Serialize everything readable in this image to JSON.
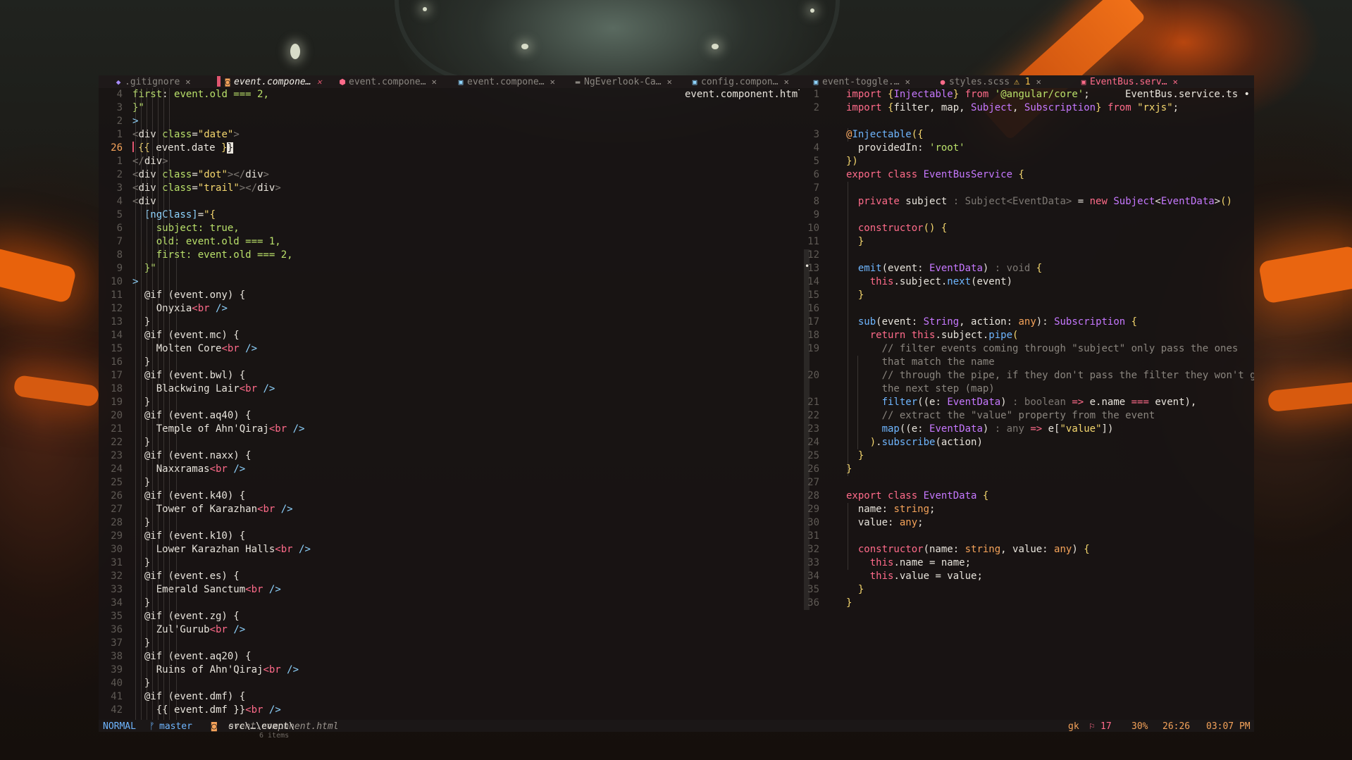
{
  "tabs": [
    {
      "icon": "git-icon",
      "icon_color": "#a88cff",
      "label": ".gitignore",
      "state": "normal"
    },
    {
      "icon": "html-icon",
      "icon_color": "#f5a35a",
      "label": "event.compone…",
      "state": "active"
    },
    {
      "icon": "angular-icon",
      "icon_color": "#ff6b8a",
      "label": "event.compone…",
      "state": "normal"
    },
    {
      "icon": "ts-icon",
      "icon_color": "#8fd4ff",
      "label": "event.compone…",
      "state": "normal"
    },
    {
      "icon": "folder-icon",
      "icon_color": "#8a8680",
      "label": "NgEverlook-Ca…",
      "state": "normal"
    },
    {
      "icon": "ts-icon",
      "icon_color": "#8fd4ff",
      "label": "config.compon…",
      "state": "normal"
    },
    {
      "icon": "ts-icon",
      "icon_color": "#8fd4ff",
      "label": "event-toggle.…",
      "state": "normal"
    },
    {
      "icon": "sass-icon",
      "icon_color": "#ff6b8a",
      "label": "styles.scss",
      "state": "warn",
      "warn": "⚠ 1"
    },
    {
      "icon": "ts-icon",
      "icon_color": "#ff6b8a",
      "label": "EventBus.serv…",
      "state": "red"
    }
  ],
  "close_glyph": "✕",
  "left_pane": {
    "title": "event.component.html",
    "lines": [
      {
        "n": "4",
        "h": "<span class=\"at\">first</span>: <span class=\"at\">event.old === 2,</span>"
      },
      {
        "n": "3",
        "h": "<span class=\"at\">}\"</span>"
      },
      {
        "n": "2",
        "h": "<span class=\"pu\">&gt;</span>"
      },
      {
        "n": "1",
        "h": "<span class=\"gr\">&lt;</span><span class=\"tg\">div</span> <span class=\"at\">class</span>=<span class=\"st\">\"date\"</span><span class=\"gr\">&gt;</span>"
      },
      {
        "n": "26",
        "h": "<span class=\"curbar\"></span><span class=\"ob\">{{</span> event.date <span class=\"ob\">}</span><span class=\"cursor\">}</span>",
        "cur": true
      },
      {
        "n": "1",
        "h": "<span class=\"gr\">&lt;/</span><span class=\"tg\">div</span><span class=\"gr\">&gt;</span>"
      },
      {
        "n": "2",
        "h": "<span class=\"gr\">&lt;</span><span class=\"tg\">div</span> <span class=\"at\">class</span>=<span class=\"st\">\"dot\"</span><span class=\"gr\">&gt;&lt;/</span><span class=\"tg\">div</span><span class=\"gr\">&gt;</span>"
      },
      {
        "n": "3",
        "h": "<span class=\"gr\">&lt;</span><span class=\"tg\">div</span> <span class=\"at\">class</span>=<span class=\"st\">\"trail\"</span><span class=\"gr\">&gt;&lt;/</span><span class=\"tg\">div</span><span class=\"gr\">&gt;</span>"
      },
      {
        "n": "4",
        "h": "<span class=\"gr\">&lt;</span><span class=\"tg\">div</span>"
      },
      {
        "n": "5",
        "h": "  <span class=\"pu\">[ngClass]</span>=<span class=\"st\">\"{</span>"
      },
      {
        "n": "6",
        "h": "    <span class=\"at\">subject: true,</span>"
      },
      {
        "n": "7",
        "h": "    <span class=\"at\">old: event.old === 1,</span>"
      },
      {
        "n": "8",
        "h": "    <span class=\"at\">first: event.old === 2,</span>"
      },
      {
        "n": "9",
        "h": "  <span class=\"at\">}\"</span>"
      },
      {
        "n": "10",
        "h": "<span class=\"pu\">&gt;</span>"
      },
      {
        "n": "11",
        "h": "  @if (event.ony) {"
      },
      {
        "n": "12",
        "h": "    Onyxia<span class=\"kw\">&lt;br</span> <span class=\"pu\">/&gt;</span>"
      },
      {
        "n": "13",
        "h": "  }"
      },
      {
        "n": "14",
        "h": "  @if (event.mc) {"
      },
      {
        "n": "15",
        "h": "    Molten Core<span class=\"kw\">&lt;br</span> <span class=\"pu\">/&gt;</span>"
      },
      {
        "n": "16",
        "h": "  }"
      },
      {
        "n": "17",
        "h": "  @if (event.bwl) {"
      },
      {
        "n": "18",
        "h": "    Blackwing Lair<span class=\"kw\">&lt;br</span> <span class=\"pu\">/&gt;</span>"
      },
      {
        "n": "19",
        "h": "  }"
      },
      {
        "n": "20",
        "h": "  @if (event.aq40) {"
      },
      {
        "n": "21",
        "h": "    Temple of Ahn'Qiraj<span class=\"kw\">&lt;br</span> <span class=\"pu\">/&gt;</span>"
      },
      {
        "n": "22",
        "h": "  }"
      },
      {
        "n": "23",
        "h": "  @if (event.naxx) {"
      },
      {
        "n": "24",
        "h": "    Naxxramas<span class=\"kw\">&lt;br</span> <span class=\"pu\">/&gt;</span>"
      },
      {
        "n": "25",
        "h": "  }"
      },
      {
        "n": "26",
        "h": "  @if (event.k40) {"
      },
      {
        "n": "27",
        "h": "    Tower of Karazhan<span class=\"kw\">&lt;br</span> <span class=\"pu\">/&gt;</span>"
      },
      {
        "n": "28",
        "h": "  }"
      },
      {
        "n": "29",
        "h": "  @if (event.k10) {"
      },
      {
        "n": "30",
        "h": "    Lower Karazhan Halls<span class=\"kw\">&lt;br</span> <span class=\"pu\">/&gt;</span>"
      },
      {
        "n": "31",
        "h": "  }"
      },
      {
        "n": "32",
        "h": "  @if (event.es) {"
      },
      {
        "n": "33",
        "h": "    Emerald Sanctum<span class=\"kw\">&lt;br</span> <span class=\"pu\">/&gt;</span>"
      },
      {
        "n": "34",
        "h": "  }"
      },
      {
        "n": "35",
        "h": "  @if (event.zg) {"
      },
      {
        "n": "36",
        "h": "    Zul'Gurub<span class=\"kw\">&lt;br</span> <span class=\"pu\">/&gt;</span>"
      },
      {
        "n": "37",
        "h": "  }"
      },
      {
        "n": "38",
        "h": "  @if (event.aq20) {"
      },
      {
        "n": "39",
        "h": "    Ruins of Ahn'Qiraj<span class=\"kw\">&lt;br</span> <span class=\"pu\">/&gt;</span>"
      },
      {
        "n": "40",
        "h": "  }"
      },
      {
        "n": "41",
        "h": "  @if (event.dmf) {"
      },
      {
        "n": "42",
        "h": "    {{ event.dmf }}<span class=\"kw\">&lt;br</span> <span class=\"pu\">/&gt;</span>"
      }
    ]
  },
  "right_pane": {
    "title": "EventBus.service.ts •",
    "lines": [
      {
        "n": "1",
        "h": "<span class=\"kw\">import</span> <span class=\"ob\">{</span><span class=\"ty\">Injectable</span><span class=\"ob\">}</span> <span class=\"kw\">from</span> <span class=\"at\">'@angular/core'</span>;"
      },
      {
        "n": "2",
        "h": "<span class=\"kw\">import</span> <span class=\"ob\">{</span>filter, map, <span class=\"ty\">Subject</span>, <span class=\"ty\">Subscription</span><span class=\"ob\">}</span> <span class=\"kw\">from</span> <span class=\"st\">\"rxjs\"</span>;"
      },
      {
        "n": "",
        "h": ""
      },
      {
        "n": "3",
        "h": "<span class=\"an\">@</span><span class=\"fn\">Injectable</span><span class=\"ob\">({</span>"
      },
      {
        "n": "4",
        "h": "  providedIn: <span class=\"at\">'root'</span>"
      },
      {
        "n": "5",
        "h": "<span class=\"ob\">})</span>"
      },
      {
        "n": "6",
        "h": "<span class=\"kw\">export class</span> <span class=\"ty\">EventBusService</span> <span class=\"ob\">{</span>"
      },
      {
        "n": "7",
        "h": ""
      },
      {
        "n": "8",
        "h": "  <span class=\"kw\">private</span> subject <span class=\"gr\">:</span> <span class=\"gr\">Subject&lt;EventData&gt;</span> = <span class=\"kw\">new</span> <span class=\"ty\">Subject</span>&lt;<span class=\"ty\">EventData</span>&gt;<span class=\"ob\">()</span>"
      },
      {
        "n": "9",
        "h": ""
      },
      {
        "n": "10",
        "h": "  <span class=\"kw\">constructor</span><span class=\"ob\">() {</span>"
      },
      {
        "n": "11",
        "h": "  <span class=\"ob\">}</span>"
      },
      {
        "n": "12",
        "h": ""
      },
      {
        "n": "13",
        "h": "  <span class=\"fn\">emit</span>(event: <span class=\"ty\">EventData</span>) <span class=\"gr\">: void</span> <span class=\"ob\">{</span>"
      },
      {
        "n": "14",
        "h": "    <span class=\"kw\">this</span>.subject.<span class=\"fn\">next</span>(event)"
      },
      {
        "n": "15",
        "h": "  <span class=\"ob\">}</span>"
      },
      {
        "n": "16",
        "h": ""
      },
      {
        "n": "17",
        "h": "  <span class=\"fn\">sub</span>(event: <span class=\"ty\">String</span>, action: <span class=\"an\">any</span>): <span class=\"ty\">Subscription</span> <span class=\"ob\">{</span>"
      },
      {
        "n": "18",
        "h": "    <span class=\"kw\">return this</span>.subject.<span class=\"fn\">pipe</span><span class=\"ob\">(</span>"
      },
      {
        "n": "19",
        "h": "      <span class=\"cm\">// filter events coming through \"subject\" only pass the ones</span>"
      },
      {
        "n": "",
        "h": "      <span class=\"cm\">that match the name</span>"
      },
      {
        "n": "20",
        "h": "      <span class=\"cm\">// through the pipe, if they don't pass the filter they won't go</span>"
      },
      {
        "n": "",
        "h": "      <span class=\"cm\">the next step (map)</span>"
      },
      {
        "n": "21",
        "h": "      <span class=\"fn\">filter</span>((e: <span class=\"ty\">EventData</span>) <span class=\"gr\">: boolean</span> <span class=\"kw\">=&gt;</span> e.name <span class=\"kw\">===</span> event),"
      },
      {
        "n": "22",
        "h": "      <span class=\"cm\">// extract the \"value\" property from the event</span>"
      },
      {
        "n": "23",
        "h": "      <span class=\"fn\">map</span>((e: <span class=\"ty\">EventData</span>) <span class=\"gr\">: any</span> <span class=\"kw\">=&gt;</span> e[<span class=\"st\">\"value\"</span>])"
      },
      {
        "n": "24",
        "h": "    <span class=\"ob\">)</span>.<span class=\"fn\">subscribe</span>(action)"
      },
      {
        "n": "25",
        "h": "  <span class=\"ob\">}</span>"
      },
      {
        "n": "26",
        "h": "<span class=\"ob\">}</span>"
      },
      {
        "n": "27",
        "h": ""
      },
      {
        "n": "28",
        "h": "<span class=\"kw\">export class</span> <span class=\"ty\">EventData</span> <span class=\"ob\">{</span>"
      },
      {
        "n": "29",
        "h": "  name: <span class=\"an\">string</span>;"
      },
      {
        "n": "30",
        "h": "  value: <span class=\"an\">any</span>;"
      },
      {
        "n": "31",
        "h": ""
      },
      {
        "n": "32",
        "h": "  <span class=\"kw\">constructor</span>(name: <span class=\"an\">string</span>, value: <span class=\"an\">any</span>) <span class=\"ob\">{</span>"
      },
      {
        "n": "33",
        "h": "    <span class=\"kw\">this</span>.name = name;"
      },
      {
        "n": "34",
        "h": "    <span class=\"kw\">this</span>.value = value;"
      },
      {
        "n": "35",
        "h": "  <span class=\"ob\">}</span>"
      },
      {
        "n": "36",
        "h": "<span class=\"ob\">}</span>"
      }
    ]
  },
  "status": {
    "mode": "NORMAL",
    "branch_icon": "ᚠ",
    "branch": "master",
    "file_icon": "◙",
    "path_prefix": "src\\…\\event\\",
    "path_file": "event.component.html",
    "user": "gk",
    "diag_icon": "⚐",
    "diag_count": "17",
    "percent": "30%",
    "position": "26:26",
    "time": "03:07 PM"
  },
  "under_text": "6 items",
  "colors": {
    "accent": "#e0556f",
    "keyword": "#ff6b8a",
    "string": "#b9e06a",
    "function": "#6fb6ff",
    "type": "#c678ff",
    "number": "#f5a35a"
  }
}
